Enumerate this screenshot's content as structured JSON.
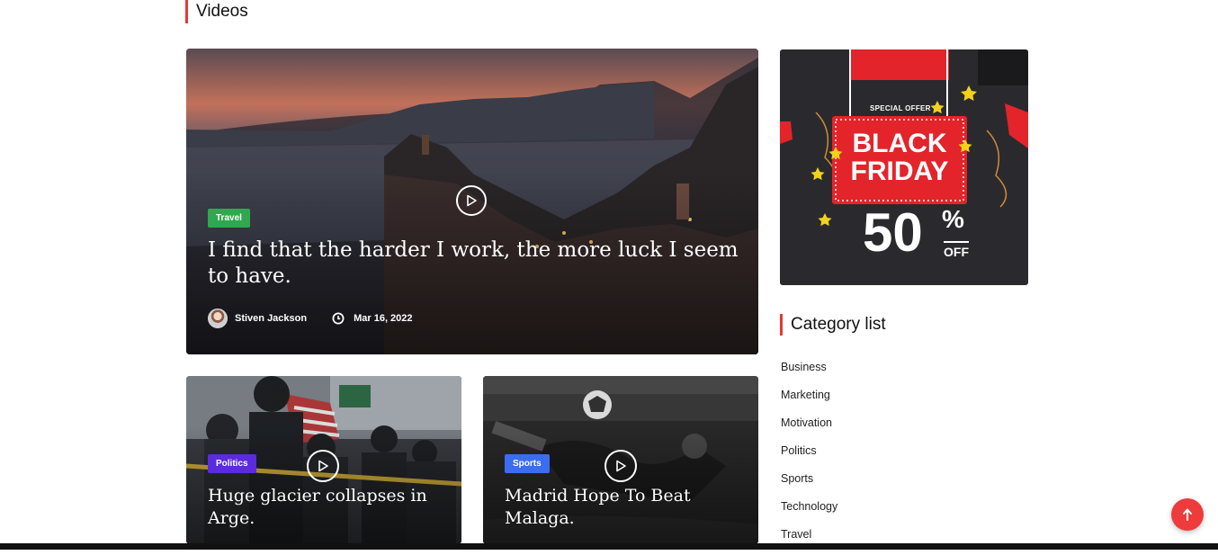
{
  "section": {
    "title": "Videos"
  },
  "featured": {
    "category": "Travel",
    "category_color": "#2fa84f",
    "title": "I find that the harder I work, the more luck I seem to have.",
    "author": "Stiven Jackson",
    "date": "Mar 16, 2022"
  },
  "cards": [
    {
      "category": "Politics",
      "category_color": "#5b2be0",
      "title": "Huge glacier collapses in Arge."
    },
    {
      "category": "Sports",
      "category_color": "#3b6df0",
      "title": "Madrid Hope To Beat Malaga."
    }
  ],
  "ad": {
    "special_offer": "SPECIAL OFFER",
    "line1": "BLACK",
    "line2": "FRIDAY",
    "discount": "50",
    "percent": "%",
    "off": "OFF"
  },
  "sidebar": {
    "category_title": "Category list",
    "categories": [
      "Business",
      "Marketing",
      "Motivation",
      "Politics",
      "Sports",
      "Technology",
      "Travel"
    ]
  },
  "colors": {
    "accent": "#e53935",
    "scroll_button": "#ee3b3b"
  }
}
